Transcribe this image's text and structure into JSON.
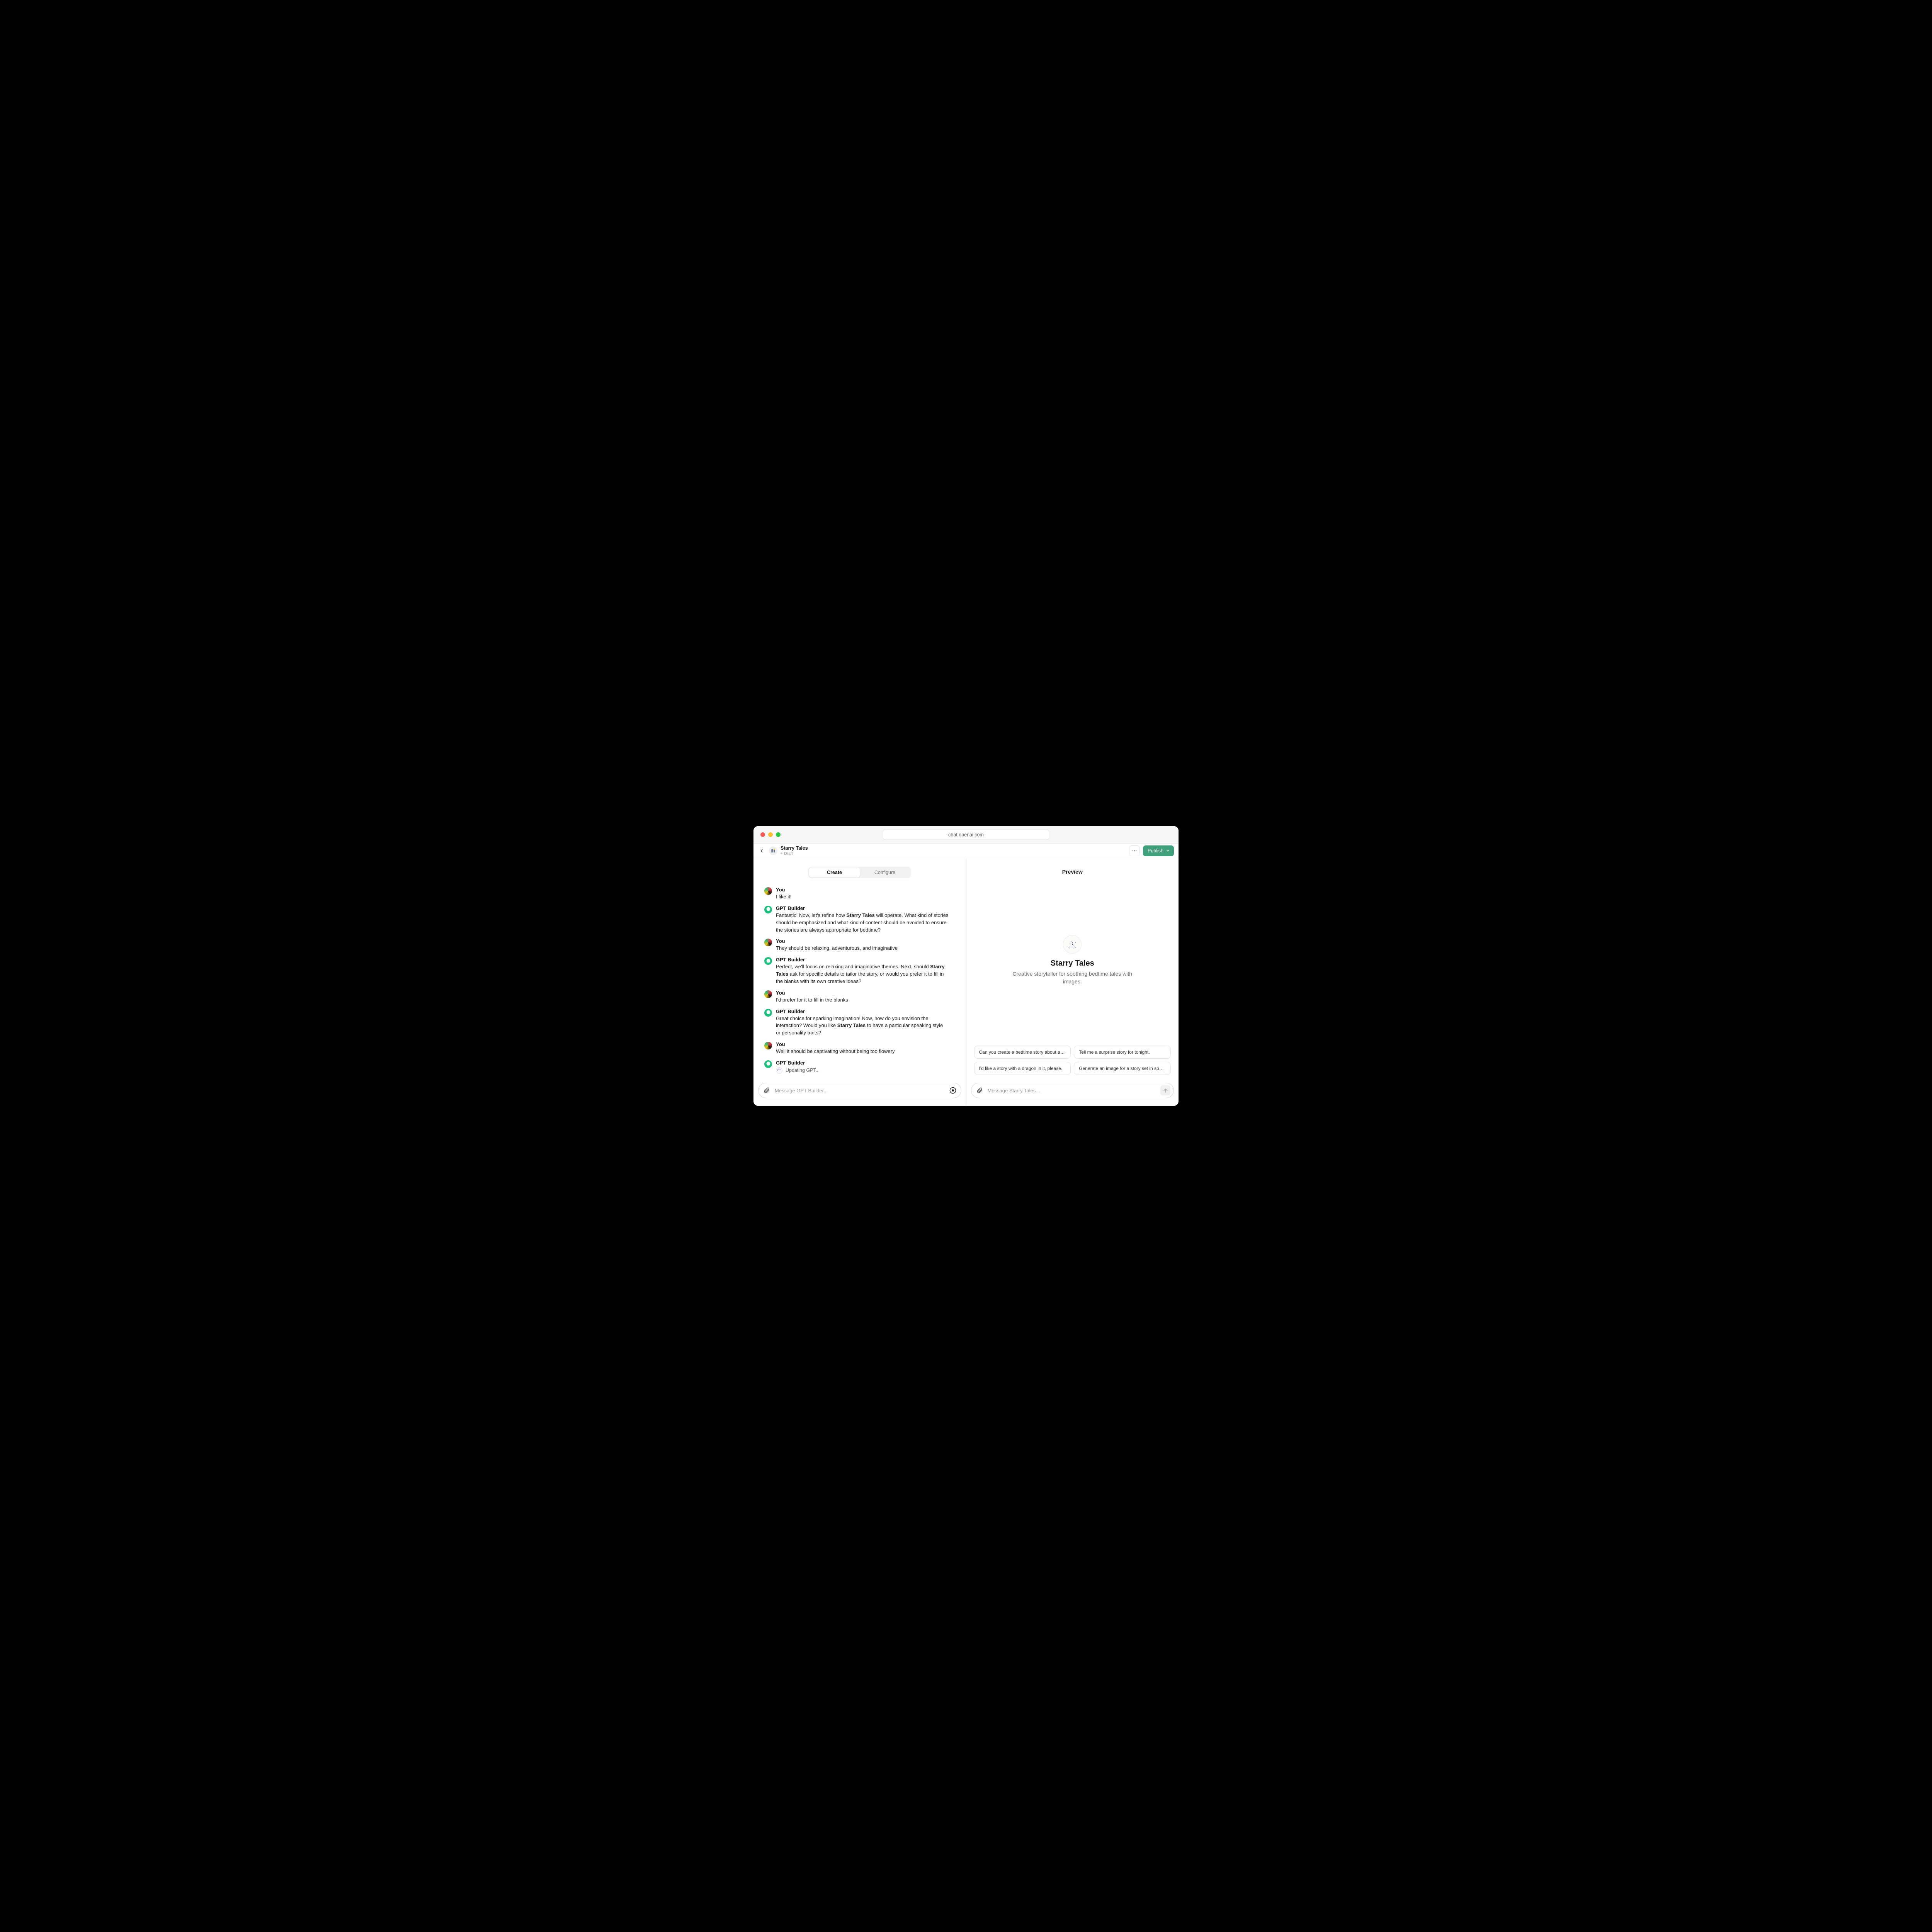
{
  "browser": {
    "url": "chat.openai.com"
  },
  "header": {
    "gpt_name": "Starry Tales",
    "status": "Draft",
    "publish_label": "Publish"
  },
  "tabs": {
    "create": "Create",
    "configure": "Configure"
  },
  "preview": {
    "title": "Preview",
    "name": "Starry Tales",
    "desc": "Creative storyteller for soothing bedtime tales with images."
  },
  "suggestions": [
    "Can you create a bedtime story about a forest?",
    "Tell me a surprise story for tonight.",
    "I'd like a story with a dragon in it, please.",
    "Generate an image for a story set in space."
  ],
  "composer": {
    "left_placeholder": "Message GPT Builder...",
    "right_placeholder": "Message Starry Tales..."
  },
  "authors": {
    "you": "You",
    "builder": "GPT Builder"
  },
  "product_name": "Starry Tales",
  "conversation": [
    {
      "role": "you",
      "text": "I like it!"
    },
    {
      "role": "builder",
      "pre": "Fantastic! Now, let's refine how ",
      "post": " will operate. What kind of stories should be emphasized and what kind of content should be avoided to ensure the stories are always appropriate for bedtime?"
    },
    {
      "role": "you",
      "text": "They should be relaxing, adventurous, and imaginative"
    },
    {
      "role": "builder",
      "pre": "Perfect, we'll focus on relaxing and imaginative themes. Next, should ",
      "post": " ask for specific details to tailor the story, or would you prefer it to fill in the blanks with its own creative ideas?"
    },
    {
      "role": "you",
      "text": " I'd prefer for it to fill in the blanks"
    },
    {
      "role": "builder",
      "pre": "Great choice for sparking imagination! Now, how do you envision the interaction? Would you like ",
      "post": " to have a particular speaking style or personality traits?"
    },
    {
      "role": "you",
      "text": "Well it should be captivating without being too flowery"
    },
    {
      "role": "builder",
      "updating": "Updating GPT..."
    }
  ]
}
